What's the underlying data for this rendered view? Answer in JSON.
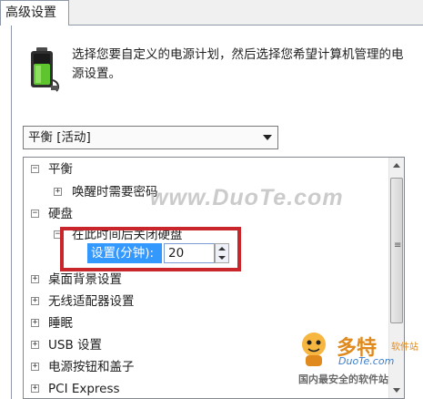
{
  "tab": {
    "label": "高级设置"
  },
  "intro": {
    "text": "选择您要自定义的电源计划，然后选择您希望计算机管理的电源设置。",
    "icon": "battery-icon"
  },
  "plan_select": {
    "value": "平衡 [活动]"
  },
  "tree": {
    "rows": [
      {
        "label": "平衡",
        "expander": "⊟"
      },
      {
        "label": "唤醒时需要密码",
        "expander": "⊞"
      },
      {
        "label": "硬盘",
        "expander": "⊟"
      },
      {
        "label": "在此时间后关闭硬盘",
        "expander": "⊟"
      },
      {
        "label": "桌面背景设置",
        "expander": "⊞"
      },
      {
        "label": "无线适配器设置",
        "expander": "⊞"
      },
      {
        "label": "睡眠",
        "expander": "⊞"
      },
      {
        "label": "USB 设置",
        "expander": "⊞"
      },
      {
        "label": "电源按钮和盖子",
        "expander": "⊞"
      },
      {
        "label": "PCI Express",
        "expander": "⊞"
      }
    ],
    "setting_label": "设置(分钟):",
    "setting_value": "20"
  },
  "watermark": {
    "text": "www.DuoTe.com",
    "logo_title": "多特",
    "logo_sub": "软件站",
    "logo_url": "DuoTe.com",
    "logo_tagline": "国内最安全的软件站"
  },
  "colors": {
    "highlight_border": "#c9262b",
    "selection": "#3399ff"
  }
}
